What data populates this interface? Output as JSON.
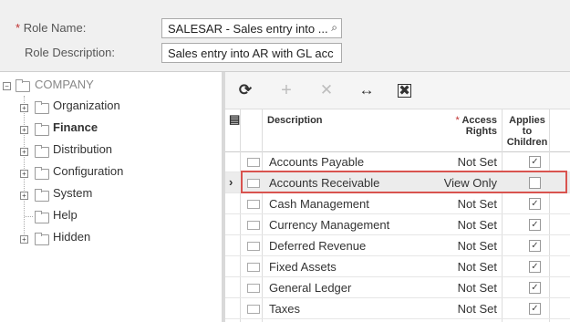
{
  "form": {
    "role_name_label": "Role Name:",
    "role_name_required": "*",
    "role_name_value": "SALESAR - Sales entry into ...",
    "role_desc_label": "Role Description:",
    "role_desc_value": "Sales entry into AR with GL acc"
  },
  "tree": {
    "root": "COMPANY",
    "items": [
      {
        "label": "Organization",
        "expandable": true
      },
      {
        "label": "Finance",
        "expandable": true,
        "bold": true
      },
      {
        "label": "Distribution",
        "expandable": true
      },
      {
        "label": "Configuration",
        "expandable": true
      },
      {
        "label": "System",
        "expandable": true
      },
      {
        "label": "Help",
        "expandable": false
      },
      {
        "label": "Hidden",
        "expandable": true
      }
    ]
  },
  "toolbar": {
    "refresh_icon": "⟳",
    "add_icon": "+",
    "delete_icon": "✕",
    "fit_icon": "↔",
    "export_icon": "✖"
  },
  "grid": {
    "col_description": "Description",
    "col_rights_req": "*",
    "col_rights": "Access Rights",
    "col_applies": "Applies to Children",
    "rows": [
      {
        "description": "Accounts Payable",
        "rights": "Not Set",
        "applies": true
      },
      {
        "description": "Accounts Receivable",
        "rights": "View Only",
        "applies": false,
        "selected": true
      },
      {
        "description": "Cash Management",
        "rights": "Not Set",
        "applies": true
      },
      {
        "description": "Currency Management",
        "rights": "Not Set",
        "applies": true
      },
      {
        "description": "Deferred Revenue",
        "rights": "Not Set",
        "applies": true
      },
      {
        "description": "Fixed Assets",
        "rights": "Not Set",
        "applies": true
      },
      {
        "description": "General Ledger",
        "rights": "Not Set",
        "applies": true
      },
      {
        "description": "Taxes",
        "rights": "Not Set",
        "applies": true
      }
    ]
  },
  "colors": {
    "highlight": "#d9534f",
    "required": "#c03030"
  }
}
